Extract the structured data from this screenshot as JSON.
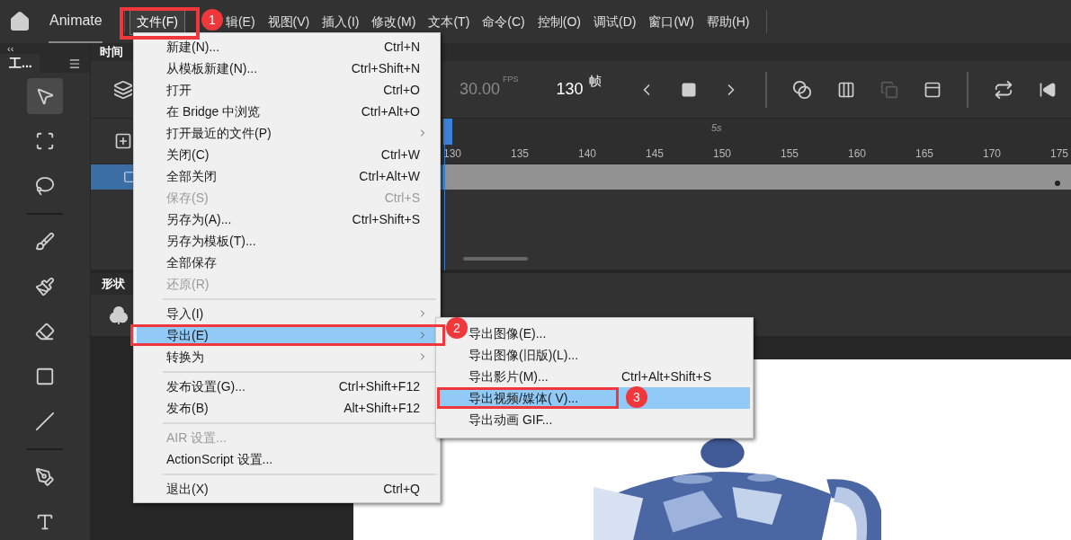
{
  "app": {
    "name": "Animate"
  },
  "menubar": [
    {
      "label": "文件(F)",
      "selected": true
    },
    {
      "label": "辑(E)",
      "selected": false
    },
    {
      "label": "视图(V)",
      "selected": false
    },
    {
      "label": "插入(I)",
      "selected": false
    },
    {
      "label": "修改(M)",
      "selected": false
    },
    {
      "label": "文本(T)",
      "selected": false
    },
    {
      "label": "命令(C)",
      "selected": false
    },
    {
      "label": "控制(O)",
      "selected": false
    },
    {
      "label": "调试(D)",
      "selected": false
    },
    {
      "label": "窗口(W)",
      "selected": false
    },
    {
      "label": "帮助(H)",
      "selected": false
    }
  ],
  "tools_panel": {
    "tab": "工...",
    "collapse": "‹‹",
    "tools": [
      {
        "kind": "select",
        "selected": true
      },
      {
        "kind": "transform",
        "selected": false
      },
      {
        "kind": "lasso",
        "selected": false
      },
      {
        "kind": "separator"
      },
      {
        "kind": "fluid-brush",
        "selected": false
      },
      {
        "kind": "brush",
        "selected": false
      },
      {
        "kind": "eraser",
        "selected": false
      },
      {
        "kind": "rectangle",
        "selected": false
      },
      {
        "kind": "line",
        "selected": false
      },
      {
        "kind": "separator"
      },
      {
        "kind": "pen",
        "selected": false
      },
      {
        "kind": "text",
        "selected": false
      }
    ]
  },
  "timeline": {
    "tab": "时间",
    "fps": "30.00",
    "fps_unit": "FPS",
    "frame": "130",
    "frame_unit": "帧",
    "time_marker": "5s",
    "frame_labels": [
      "130",
      "135",
      "140",
      "145",
      "150",
      "155",
      "160",
      "165",
      "170",
      "175"
    ]
  },
  "shape_panel": {
    "tab": "形状"
  },
  "file_menu": [
    {
      "kind": "item",
      "label": "新建(N)...",
      "shortcut": "Ctrl+N",
      "disabled": false
    },
    {
      "kind": "item",
      "label": "从模板新建(N)...",
      "shortcut": "Ctrl+Shift+N",
      "disabled": false
    },
    {
      "kind": "item",
      "label": "打开",
      "shortcut": "Ctrl+O",
      "disabled": false
    },
    {
      "kind": "item",
      "label": "在 Bridge 中浏览",
      "shortcut": "Ctrl+Alt+O",
      "disabled": false
    },
    {
      "kind": "submenu",
      "label": "打开最近的文件(P)",
      "selected": false
    },
    {
      "kind": "item",
      "label": "关闭(C)",
      "shortcut": "Ctrl+W",
      "disabled": false
    },
    {
      "kind": "item",
      "label": "全部关闭",
      "shortcut": "Ctrl+Alt+W",
      "disabled": false
    },
    {
      "kind": "item",
      "label": "保存(S)",
      "shortcut": "Ctrl+S",
      "disabled": true
    },
    {
      "kind": "item",
      "label": "另存为(A)...",
      "shortcut": "Ctrl+Shift+S",
      "disabled": false
    },
    {
      "kind": "item",
      "label": "另存为模板(T)...",
      "disabled": false
    },
    {
      "kind": "item",
      "label": "全部保存",
      "disabled": false
    },
    {
      "kind": "item",
      "label": "还原(R)",
      "disabled": true
    },
    {
      "kind": "separator"
    },
    {
      "kind": "submenu",
      "label": "导入(I)",
      "selected": false
    },
    {
      "kind": "submenu",
      "label": "导出(E)",
      "selected": true
    },
    {
      "kind": "submenu",
      "label": "转换为",
      "selected": false
    },
    {
      "kind": "separator"
    },
    {
      "kind": "item",
      "label": "发布设置(G)...",
      "shortcut": "Ctrl+Shift+F12",
      "disabled": false
    },
    {
      "kind": "item",
      "label": "发布(B)",
      "shortcut": "Alt+Shift+F12",
      "disabled": false
    },
    {
      "kind": "separator"
    },
    {
      "kind": "item",
      "label": "AIR 设置...",
      "disabled": true
    },
    {
      "kind": "item",
      "label": "ActionScript 设置...",
      "disabled": false
    },
    {
      "kind": "separator"
    },
    {
      "kind": "item",
      "label": "退出(X)",
      "shortcut": "Ctrl+Q",
      "disabled": false
    }
  ],
  "export_submenu": [
    {
      "label": "导出图像(E)...",
      "selected": false
    },
    {
      "label": "导出图像(旧版)(L)...",
      "selected": false
    },
    {
      "label": "导出影片(M)...",
      "shortcut": "Ctrl+Alt+Shift+S",
      "selected": false
    },
    {
      "label": "导出视频/媒体( V)...",
      "selected": true
    },
    {
      "label": "导出动画 GIF...",
      "selected": false
    }
  ],
  "steps": [
    "1",
    "2",
    "3"
  ]
}
